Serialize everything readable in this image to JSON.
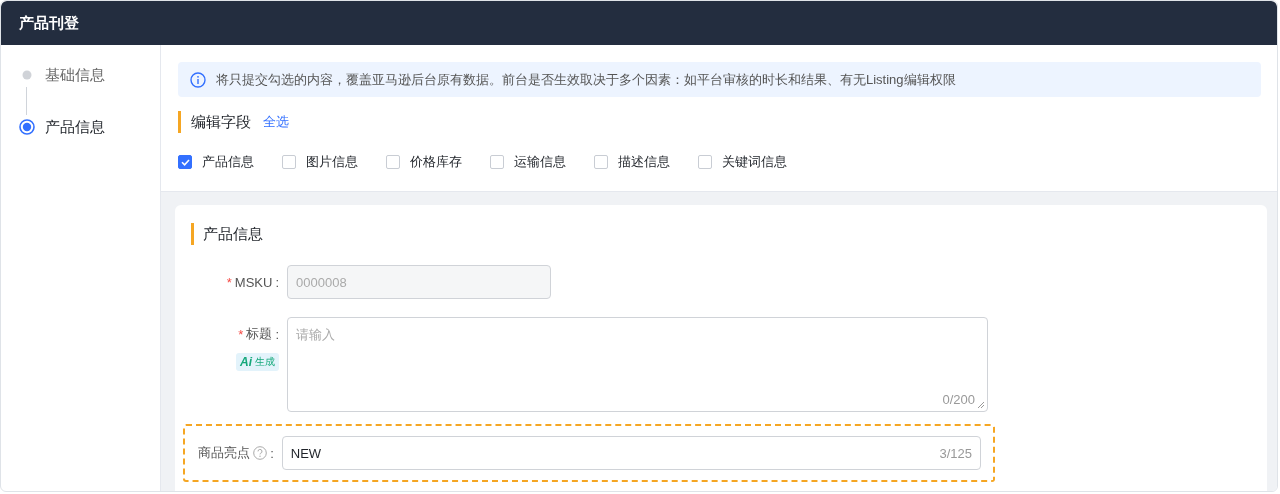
{
  "header": {
    "title": "产品刊登"
  },
  "steps": [
    {
      "label": "基础信息",
      "selected": false
    },
    {
      "label": "产品信息",
      "selected": true
    }
  ],
  "notice": {
    "text": "将只提交勾选的内容，覆盖亚马逊后台原有数据。前台是否生效取决于多个因素：如平台审核的时长和结果、有无Listing编辑权限"
  },
  "edit_fields": {
    "title": "编辑字段",
    "select_all": "全选",
    "options": [
      {
        "label": "产品信息",
        "checked": true
      },
      {
        "label": "图片信息",
        "checked": false
      },
      {
        "label": "价格库存",
        "checked": false
      },
      {
        "label": "运输信息",
        "checked": false
      },
      {
        "label": "描述信息",
        "checked": false
      },
      {
        "label": "关键词信息",
        "checked": false
      }
    ]
  },
  "section": {
    "title": "产品信息",
    "fields": [
      {
        "kind": "input",
        "required_mark": "*",
        "label": "MSKU",
        "colon": ":",
        "value": "0000008",
        "disabled": true
      },
      {
        "kind": "textarea",
        "required_mark": "*",
        "label": "标题",
        "colon": ":",
        "placeholder": "请输入",
        "ai_logo": "Ai",
        "ai_label": "生成",
        "counter": "0/200"
      },
      {
        "kind": "input",
        "label": "商品亮点",
        "help": true,
        "colon": ":",
        "value": "NEW",
        "counter": "3/125",
        "highlighted": true
      }
    ]
  }
}
